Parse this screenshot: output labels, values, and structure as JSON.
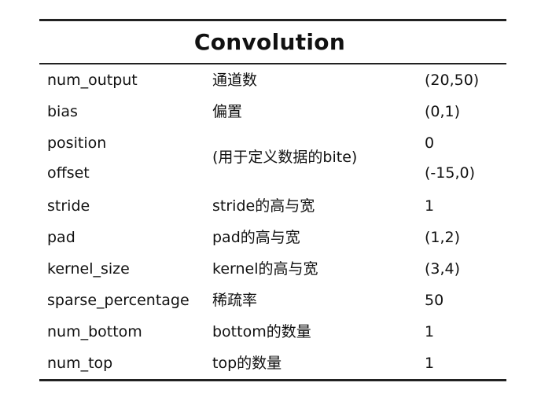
{
  "table": {
    "title": "Convolution",
    "rows": [
      {
        "key": "num_output",
        "desc": "通道数",
        "value": "(20,50)"
      },
      {
        "key": "bias",
        "desc": "偏置",
        "value": "(0,1)"
      },
      {
        "key": "position",
        "desc": "",
        "value": "0"
      },
      {
        "key": "offset",
        "desc": "",
        "value": "(-15,0)"
      },
      {
        "key": "stride",
        "desc": "stride的高与宽",
        "value": "1"
      },
      {
        "key": "pad",
        "desc": "pad的高与宽",
        "value": "(1,2)"
      },
      {
        "key": "kernel_size",
        "desc": "kernel的高与宽",
        "value": "(3,4)"
      },
      {
        "key": "sparse_percentage",
        "desc": "稀疏率",
        "value": "50"
      },
      {
        "key": "num_bottom",
        "desc": "bottom的数量",
        "value": "1"
      },
      {
        "key": "num_top",
        "desc": "top的数量",
        "value": "1"
      }
    ],
    "merged_desc": "(用于定义数据的bite)"
  }
}
